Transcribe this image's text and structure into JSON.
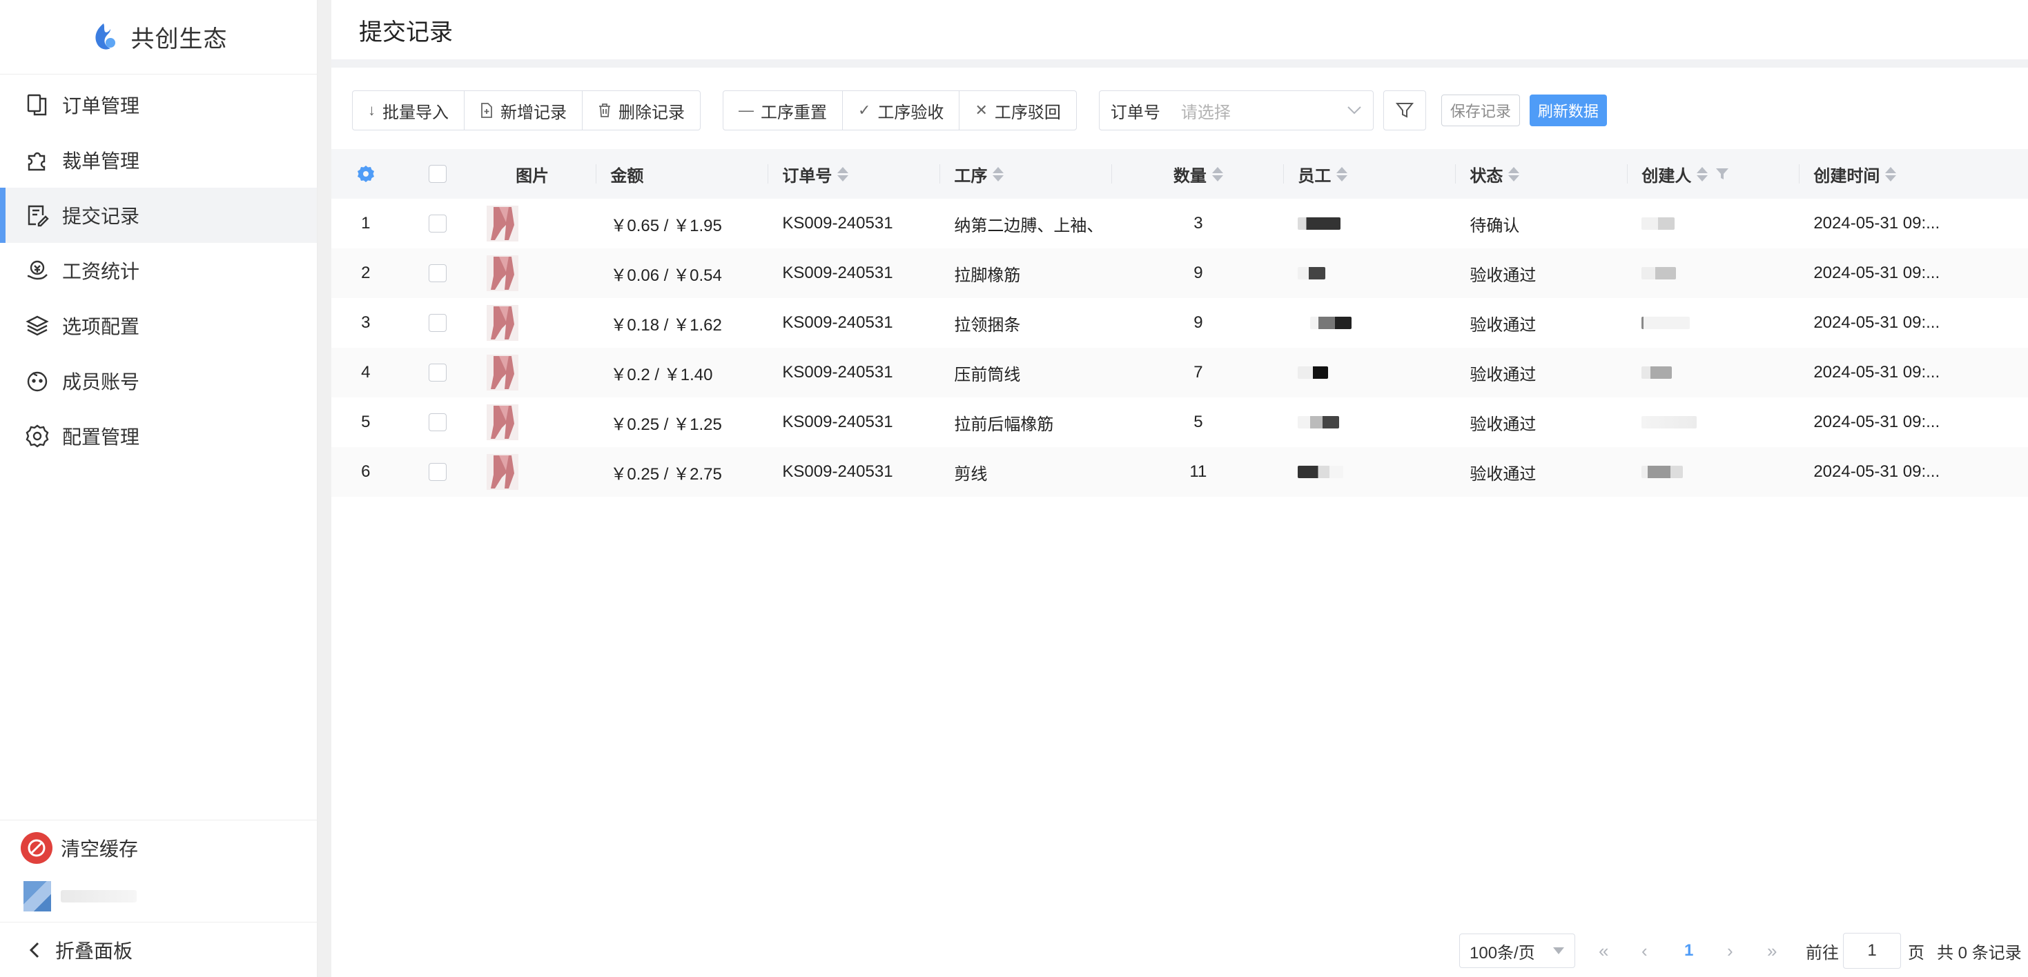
{
  "app": {
    "brand": "共创生态"
  },
  "sidebar": {
    "items": [
      {
        "label": "订单管理",
        "icon": "copy-icon",
        "active": false
      },
      {
        "label": "裁单管理",
        "icon": "puzzle-icon",
        "active": false
      },
      {
        "label": "提交记录",
        "icon": "edit-note-icon",
        "active": true
      },
      {
        "label": "工资统计",
        "icon": "wallet-icon",
        "active": false
      },
      {
        "label": "选项配置",
        "icon": "layers-icon",
        "active": false
      },
      {
        "label": "成员账号",
        "icon": "face-icon",
        "active": false
      },
      {
        "label": "配置管理",
        "icon": "gear-icon",
        "active": false
      }
    ],
    "clear_cache": "清空缓存",
    "collapse": "折叠面板"
  },
  "page": {
    "title": "提交记录"
  },
  "toolbar": {
    "group1": [
      {
        "label": "批量导入",
        "icon": "arrow-down-icon"
      },
      {
        "label": "新增记录",
        "icon": "file-plus-icon"
      },
      {
        "label": "删除记录",
        "icon": "trash-icon"
      }
    ],
    "group2": [
      {
        "label": "工序重置",
        "icon": "minus-icon"
      },
      {
        "label": "工序验收",
        "icon": "check-icon"
      },
      {
        "label": "工序驳回",
        "icon": "close-icon"
      }
    ],
    "order_select": {
      "label": "订单号",
      "placeholder": "请选择"
    },
    "save": "保存记录",
    "refresh": "刷新数据"
  },
  "table": {
    "headers": {
      "image": "图片",
      "amount": "金额",
      "order": "订单号",
      "process": "工序",
      "quantity": "数量",
      "employee": "员工",
      "status": "状态",
      "creator": "创建人",
      "created_time": "创建时间"
    },
    "rows": [
      {
        "idx": "1",
        "amount": "￥0.65 / ￥1.95",
        "order": "KS009-240531",
        "process": "纳第二边膊、上袖、",
        "quantity": "3",
        "status": "待确认",
        "time": "2024-05-31 09:..."
      },
      {
        "idx": "2",
        "amount": "￥0.06 / ￥0.54",
        "order": "KS009-240531",
        "process": "拉脚橡筋",
        "quantity": "9",
        "status": "验收通过",
        "time": "2024-05-31 09:..."
      },
      {
        "idx": "3",
        "amount": "￥0.18 / ￥1.62",
        "order": "KS009-240531",
        "process": "拉领捆条",
        "quantity": "9",
        "status": "验收通过",
        "time": "2024-05-31 09:..."
      },
      {
        "idx": "4",
        "amount": "￥0.2 / ￥1.40",
        "order": "KS009-240531",
        "process": "压前筒线",
        "quantity": "7",
        "status": "验收通过",
        "time": "2024-05-31 09:..."
      },
      {
        "idx": "5",
        "amount": "￥0.25 / ￥1.25",
        "order": "KS009-240531",
        "process": "拉前后幅橡筋",
        "quantity": "5",
        "status": "验收通过",
        "time": "2024-05-31 09:..."
      },
      {
        "idx": "6",
        "amount": "￥0.25 / ￥2.75",
        "order": "KS009-240531",
        "process": "剪线",
        "quantity": "11",
        "status": "验收通过",
        "time": "2024-05-31 09:..."
      }
    ]
  },
  "pagination": {
    "page_size": "100条/页",
    "current_page": "1",
    "goto_label": "前往",
    "goto_value": "1",
    "goto_unit": "页",
    "total": "共 0 条记录"
  },
  "colors": {
    "accent": "#4f9cf7",
    "active_bar": "#5b9cf2",
    "danger": "#e0413c"
  }
}
